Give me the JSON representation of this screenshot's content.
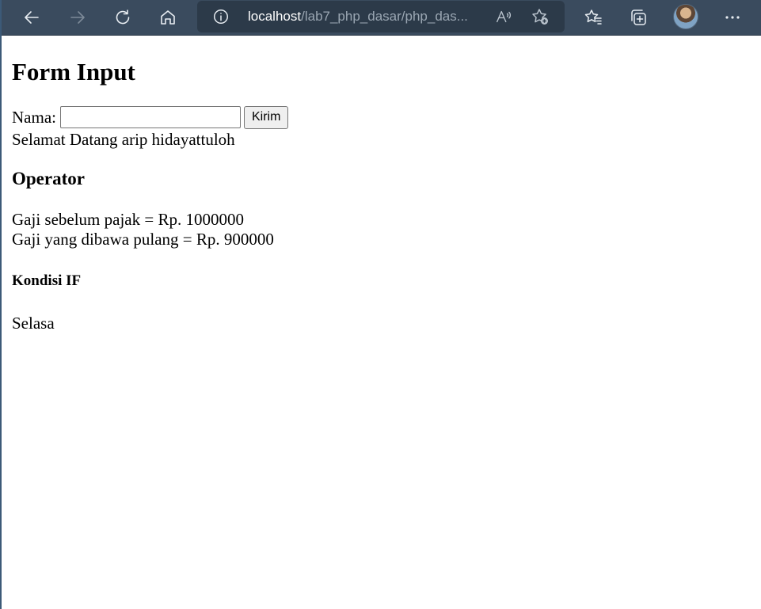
{
  "browser": {
    "url_host": "localhost",
    "url_path": "/lab7_php_dasar/php_das...",
    "icons": {
      "back": "back-arrow-icon",
      "forward": "forward-arrow-icon",
      "refresh": "refresh-icon",
      "home": "home-icon",
      "site_info": "info-icon",
      "read_aloud": "read-aloud-icon",
      "add_favorite": "add-favorite-icon",
      "favorites": "favorites-icon",
      "collections": "collections-icon",
      "profile": "avatar",
      "menu": "more-menu-icon"
    }
  },
  "page": {
    "heading": "Form Input",
    "form": {
      "label": "Nama:",
      "input_value": "",
      "submit_label": "Kirim"
    },
    "welcome_text": "Selamat Datang arip hidayattuloh",
    "operator_heading": "Operator",
    "gaji_sebelum": "Gaji sebelum pajak = Rp. 1000000",
    "gaji_dibawa": "Gaji yang dibawa pulang = Rp. 900000",
    "kondisi_heading": "Kondisi IF",
    "day_text": "Selasa"
  },
  "colors": {
    "toolbar_bg": "#3a4b5e",
    "address_bg": "#2c3a49",
    "page_bg": "#ffffff"
  }
}
